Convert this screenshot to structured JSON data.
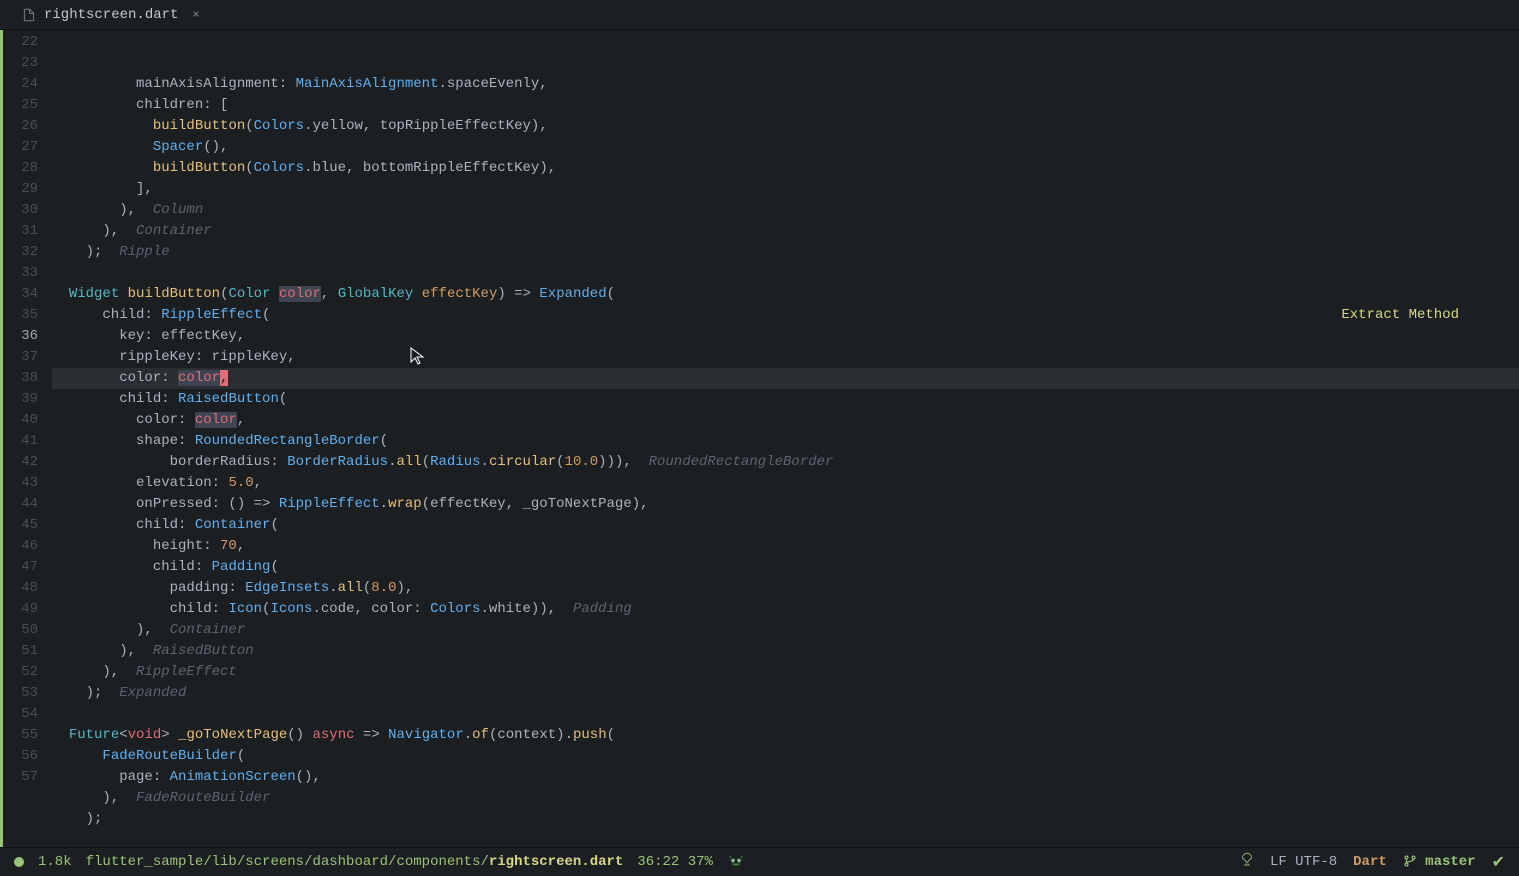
{
  "tab": {
    "filename": "rightscreen.dart",
    "close": "×"
  },
  "gutter": {
    "start": 22,
    "end": 57,
    "active": 36
  },
  "code_lines": [
    {
      "n": 22,
      "segs": [
        {
          "t": "          mainAxisAlignment: ",
          "c": "c-plain"
        },
        {
          "t": "MainAxisAlignment",
          "c": "c-class"
        },
        {
          "t": ".spaceEvenly,",
          "c": "c-plain"
        }
      ]
    },
    {
      "n": 23,
      "segs": [
        {
          "t": "          children: [",
          "c": "c-plain"
        }
      ]
    },
    {
      "n": 24,
      "segs": [
        {
          "t": "            ",
          "c": "c-plain"
        },
        {
          "t": "buildButton",
          "c": "c-method"
        },
        {
          "t": "(",
          "c": "c-plain"
        },
        {
          "t": "Colors",
          "c": "c-class"
        },
        {
          "t": ".yellow, topRippleEffectKey),",
          "c": "c-plain"
        }
      ]
    },
    {
      "n": 25,
      "segs": [
        {
          "t": "            ",
          "c": "c-plain"
        },
        {
          "t": "Spacer",
          "c": "c-class"
        },
        {
          "t": "(),",
          "c": "c-plain"
        }
      ]
    },
    {
      "n": 26,
      "segs": [
        {
          "t": "            ",
          "c": "c-plain"
        },
        {
          "t": "buildButton",
          "c": "c-method"
        },
        {
          "t": "(",
          "c": "c-plain"
        },
        {
          "t": "Colors",
          "c": "c-class"
        },
        {
          "t": ".blue, bottomRippleEffectKey),",
          "c": "c-plain"
        }
      ]
    },
    {
      "n": 27,
      "segs": [
        {
          "t": "          ],",
          "c": "c-plain"
        }
      ]
    },
    {
      "n": 28,
      "segs": [
        {
          "t": "        ),  ",
          "c": "c-plain"
        },
        {
          "t": "Column",
          "c": "c-comment"
        }
      ]
    },
    {
      "n": 29,
      "segs": [
        {
          "t": "      ),  ",
          "c": "c-plain"
        },
        {
          "t": "Container",
          "c": "c-comment"
        }
      ]
    },
    {
      "n": 30,
      "segs": [
        {
          "t": "    );  ",
          "c": "c-plain"
        },
        {
          "t": "Ripple",
          "c": "c-comment"
        }
      ]
    },
    {
      "n": 31,
      "segs": [
        {
          "t": "",
          "c": "c-plain"
        }
      ]
    },
    {
      "n": 32,
      "segs": [
        {
          "t": "  ",
          "c": "c-plain"
        },
        {
          "t": "Widget",
          "c": "c-type"
        },
        {
          "t": " ",
          "c": "c-plain"
        },
        {
          "t": "buildButton",
          "c": "c-method"
        },
        {
          "t": "(",
          "c": "c-plain"
        },
        {
          "t": "Color",
          "c": "c-type"
        },
        {
          "t": " ",
          "c": "c-plain"
        },
        {
          "t": "color",
          "c": "c-hl-word"
        },
        {
          "t": ", ",
          "c": "c-plain"
        },
        {
          "t": "GlobalKey",
          "c": "c-type"
        },
        {
          "t": " ",
          "c": "c-plain"
        },
        {
          "t": "effectKey",
          "c": "c-param"
        },
        {
          "t": ") => ",
          "c": "c-plain"
        },
        {
          "t": "Expanded",
          "c": "c-class"
        },
        {
          "t": "(",
          "c": "c-plain"
        }
      ]
    },
    {
      "n": 33,
      "segs": [
        {
          "t": "      child: ",
          "c": "c-plain"
        },
        {
          "t": "RippleEffect",
          "c": "c-class"
        },
        {
          "t": "(",
          "c": "c-plain"
        }
      ]
    },
    {
      "n": 34,
      "segs": [
        {
          "t": "        key: effectKey,",
          "c": "c-plain"
        }
      ]
    },
    {
      "n": 35,
      "segs": [
        {
          "t": "        rippleKey: rippleKey,",
          "c": "c-plain"
        }
      ]
    },
    {
      "n": 36,
      "hl": true,
      "segs": [
        {
          "t": "        color: ",
          "c": "c-plain"
        },
        {
          "t": "color",
          "c": "c-hl-word"
        },
        {
          "t": ",",
          "c": "c-cursor"
        }
      ]
    },
    {
      "n": 37,
      "segs": [
        {
          "t": "        child: ",
          "c": "c-plain"
        },
        {
          "t": "RaisedButton",
          "c": "c-class"
        },
        {
          "t": "(",
          "c": "c-plain"
        }
      ]
    },
    {
      "n": 38,
      "segs": [
        {
          "t": "          color: ",
          "c": "c-plain"
        },
        {
          "t": "color",
          "c": "c-hl-word"
        },
        {
          "t": ",",
          "c": "c-plain"
        }
      ]
    },
    {
      "n": 39,
      "segs": [
        {
          "t": "          shape: ",
          "c": "c-plain"
        },
        {
          "t": "RoundedRectangleBorder",
          "c": "c-class"
        },
        {
          "t": "(",
          "c": "c-plain"
        }
      ]
    },
    {
      "n": 40,
      "segs": [
        {
          "t": "              borderRadius: ",
          "c": "c-plain"
        },
        {
          "t": "BorderRadius",
          "c": "c-class"
        },
        {
          "t": ".",
          "c": "c-plain"
        },
        {
          "t": "all",
          "c": "c-method"
        },
        {
          "t": "(",
          "c": "c-plain"
        },
        {
          "t": "Radius",
          "c": "c-class"
        },
        {
          "t": ".",
          "c": "c-plain"
        },
        {
          "t": "circular",
          "c": "c-method"
        },
        {
          "t": "(",
          "c": "c-plain"
        },
        {
          "t": "10.0",
          "c": "c-number"
        },
        {
          "t": "))),  ",
          "c": "c-plain"
        },
        {
          "t": "RoundedRectangleBorder",
          "c": "c-comment"
        }
      ]
    },
    {
      "n": 41,
      "segs": [
        {
          "t": "          elevation: ",
          "c": "c-plain"
        },
        {
          "t": "5.0",
          "c": "c-number"
        },
        {
          "t": ",",
          "c": "c-plain"
        }
      ]
    },
    {
      "n": 42,
      "segs": [
        {
          "t": "          onPressed: () => ",
          "c": "c-plain"
        },
        {
          "t": "RippleEffect",
          "c": "c-class"
        },
        {
          "t": ".",
          "c": "c-plain"
        },
        {
          "t": "wrap",
          "c": "c-method"
        },
        {
          "t": "(effectKey, _goToNextPage),",
          "c": "c-plain"
        }
      ]
    },
    {
      "n": 43,
      "segs": [
        {
          "t": "          child: ",
          "c": "c-plain"
        },
        {
          "t": "Container",
          "c": "c-class"
        },
        {
          "t": "(",
          "c": "c-plain"
        }
      ]
    },
    {
      "n": 44,
      "segs": [
        {
          "t": "            height: ",
          "c": "c-plain"
        },
        {
          "t": "70",
          "c": "c-number"
        },
        {
          "t": ",",
          "c": "c-plain"
        }
      ]
    },
    {
      "n": 45,
      "segs": [
        {
          "t": "            child: ",
          "c": "c-plain"
        },
        {
          "t": "Padding",
          "c": "c-class"
        },
        {
          "t": "(",
          "c": "c-plain"
        }
      ]
    },
    {
      "n": 46,
      "segs": [
        {
          "t": "              padding: ",
          "c": "c-plain"
        },
        {
          "t": "EdgeInsets",
          "c": "c-class"
        },
        {
          "t": ".",
          "c": "c-plain"
        },
        {
          "t": "all",
          "c": "c-method"
        },
        {
          "t": "(",
          "c": "c-plain"
        },
        {
          "t": "8.0",
          "c": "c-number"
        },
        {
          "t": "),",
          "c": "c-plain"
        }
      ]
    },
    {
      "n": 47,
      "segs": [
        {
          "t": "              child: ",
          "c": "c-plain"
        },
        {
          "t": "Icon",
          "c": "c-class"
        },
        {
          "t": "(",
          "c": "c-plain"
        },
        {
          "t": "Icons",
          "c": "c-class"
        },
        {
          "t": ".code, color: ",
          "c": "c-plain"
        },
        {
          "t": "Colors",
          "c": "c-class"
        },
        {
          "t": ".white)),  ",
          "c": "c-plain"
        },
        {
          "t": "Padding",
          "c": "c-comment"
        }
      ]
    },
    {
      "n": 48,
      "segs": [
        {
          "t": "          ),  ",
          "c": "c-plain"
        },
        {
          "t": "Container",
          "c": "c-comment"
        }
      ]
    },
    {
      "n": 49,
      "segs": [
        {
          "t": "        ),  ",
          "c": "c-plain"
        },
        {
          "t": "RaisedButton",
          "c": "c-comment"
        }
      ]
    },
    {
      "n": 50,
      "segs": [
        {
          "t": "      ),  ",
          "c": "c-plain"
        },
        {
          "t": "RippleEffect",
          "c": "c-comment"
        }
      ]
    },
    {
      "n": 51,
      "segs": [
        {
          "t": "    );  ",
          "c": "c-plain"
        },
        {
          "t": "Expanded",
          "c": "c-comment"
        }
      ]
    },
    {
      "n": 52,
      "segs": [
        {
          "t": "",
          "c": "c-plain"
        }
      ]
    },
    {
      "n": 53,
      "segs": [
        {
          "t": "  ",
          "c": "c-plain"
        },
        {
          "t": "Future",
          "c": "c-type"
        },
        {
          "t": "<",
          "c": "c-plain"
        },
        {
          "t": "void",
          "c": "c-keyword"
        },
        {
          "t": "> ",
          "c": "c-plain"
        },
        {
          "t": "_goToNextPage",
          "c": "c-method"
        },
        {
          "t": "() ",
          "c": "c-plain"
        },
        {
          "t": "async",
          "c": "c-keyword"
        },
        {
          "t": " => ",
          "c": "c-plain"
        },
        {
          "t": "Navigator",
          "c": "c-class"
        },
        {
          "t": ".",
          "c": "c-plain"
        },
        {
          "t": "of",
          "c": "c-method"
        },
        {
          "t": "(context).",
          "c": "c-plain"
        },
        {
          "t": "push",
          "c": "c-method"
        },
        {
          "t": "(",
          "c": "c-plain"
        }
      ]
    },
    {
      "n": 54,
      "segs": [
        {
          "t": "      ",
          "c": "c-plain"
        },
        {
          "t": "FadeRouteBuilder",
          "c": "c-class"
        },
        {
          "t": "(",
          "c": "c-plain"
        }
      ]
    },
    {
      "n": 55,
      "segs": [
        {
          "t": "        page: ",
          "c": "c-plain"
        },
        {
          "t": "AnimationScreen",
          "c": "c-class"
        },
        {
          "t": "(),",
          "c": "c-plain"
        }
      ]
    },
    {
      "n": 56,
      "segs": [
        {
          "t": "      ),  ",
          "c": "c-plain"
        },
        {
          "t": "FadeRouteBuilder",
          "c": "c-comment"
        }
      ]
    },
    {
      "n": 57,
      "segs": [
        {
          "t": "    );",
          "c": "c-plain"
        }
      ]
    }
  ],
  "hint": "Extract Method",
  "status": {
    "size": "1.8k",
    "path": "flutter_sample/lib/screens/dashboard/components/",
    "file": "rightscreen.dart",
    "pos": "36:22 37%",
    "encoding": "LF UTF-8",
    "lang": "Dart",
    "branch": "master"
  }
}
